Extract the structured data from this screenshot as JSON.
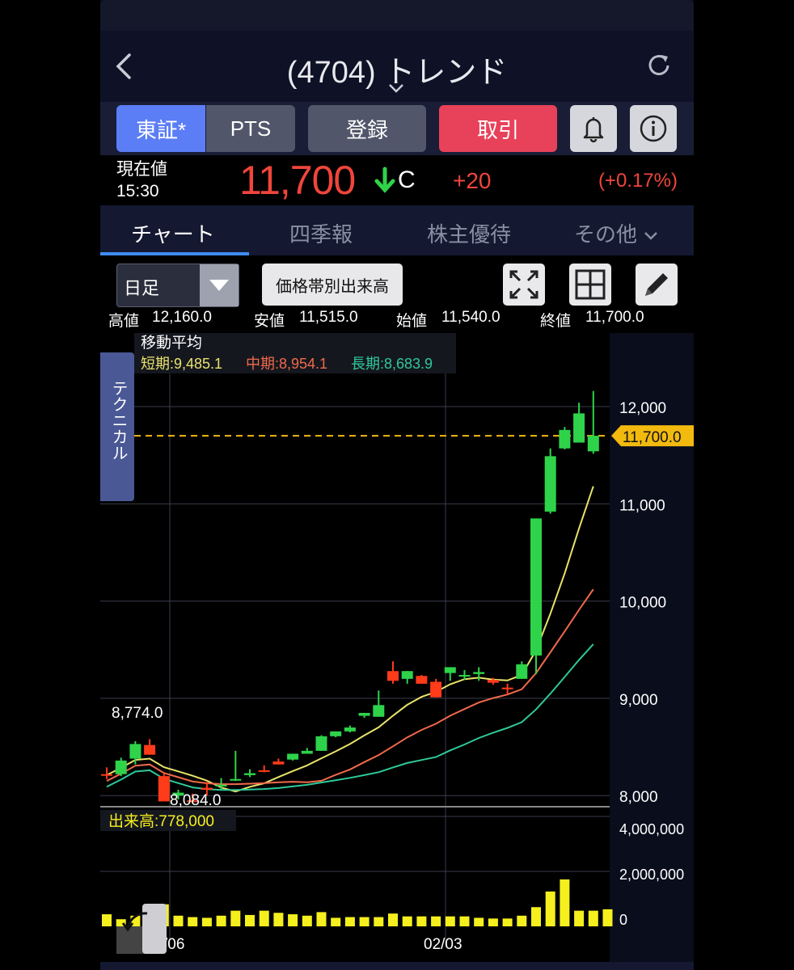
{
  "header": {
    "title": "(4704) トレンド",
    "back_icon": "chevron-left-icon",
    "refresh_icon": "refresh-icon"
  },
  "toolbar": {
    "tse_label": "東証*",
    "pts_label": "PTS",
    "register_label": "登録",
    "trade_label": "取引"
  },
  "price": {
    "label": "現在値",
    "time": "15:30",
    "value": "11,700",
    "suffix": "C",
    "change": "+20",
    "change_pct": "(+0.17%)"
  },
  "tabs": [
    "チャート",
    "四季報",
    "株主優待",
    "その他"
  ],
  "chart_controls": {
    "period": "日足",
    "volume_profile": "価格帯別出来高"
  },
  "ohlc": {
    "high_label": "高値",
    "high": "12,160.0",
    "low_label": "安値",
    "low": "11,515.0",
    "open_label": "始値",
    "open": "11,540.0",
    "close_label": "終値",
    "close": "11,700.0"
  },
  "colors": {
    "up": "#2ed34a",
    "down": "#ff3b1a",
    "short_ma": "#e9e36b",
    "mid_ma": "#f06a4a",
    "long_ma": "#2ec99a",
    "volume": "#f5ef1e",
    "accent": "#3f8cf2"
  },
  "chart_data": {
    "type": "candlestick",
    "title": "移動平均",
    "technical_tab": "テクニカル",
    "ma_legend": [
      {
        "name": "短期",
        "value": "9,485.1"
      },
      {
        "name": "中期",
        "value": "8,954.1"
      },
      {
        "name": "長期",
        "value": "8,683.9"
      }
    ],
    "price_ticks": [
      12000,
      11000,
      10000,
      9000,
      8000
    ],
    "price_tick_labels": [
      "12,000",
      "11,000",
      "10,000",
      "9,000",
      "8,000"
    ],
    "current_price_label": "11,700.0",
    "current_price": 11700,
    "max_annotation": "8,774.0",
    "min_annotation": "8,084.0",
    "volume_label": "出来高:778,000",
    "volume_ticks": [
      "4,000,000",
      "2,000,000",
      "0"
    ],
    "x_labels": [
      "/06",
      "02/03"
    ],
    "candles": [
      {
        "o": 8220,
        "h": 8290,
        "l": 8170,
        "c": 8210
      },
      {
        "o": 8220,
        "h": 8390,
        "l": 8200,
        "c": 8360
      },
      {
        "o": 8380,
        "h": 8560,
        "l": 8320,
        "c": 8530
      },
      {
        "o": 8520,
        "h": 8580,
        "l": 8430,
        "c": 8420
      },
      {
        "o": 8200,
        "h": 8230,
        "l": 7950,
        "c": 7940
      },
      {
        "o": 8000,
        "h": 8060,
        "l": 7960,
        "c": 8030
      },
      {
        "o": 7950,
        "h": 8020,
        "l": 7920,
        "c": 7940
      },
      {
        "o": 8080,
        "h": 8140,
        "l": 8000,
        "c": 8060
      },
      {
        "o": 8100,
        "h": 8180,
        "l": 8060,
        "c": 8110
      },
      {
        "o": 8160,
        "h": 8460,
        "l": 8150,
        "c": 8170
      },
      {
        "o": 8210,
        "h": 8270,
        "l": 8190,
        "c": 8230
      },
      {
        "o": 8260,
        "h": 8310,
        "l": 8240,
        "c": 8250
      },
      {
        "o": 8350,
        "h": 8380,
        "l": 8320,
        "c": 8320
      },
      {
        "o": 8370,
        "h": 8390,
        "l": 8360,
        "c": 8430
      },
      {
        "o": 8430,
        "h": 8490,
        "l": 8430,
        "c": 8460
      },
      {
        "o": 8460,
        "h": 8620,
        "l": 8460,
        "c": 8610
      },
      {
        "o": 8610,
        "h": 8660,
        "l": 8600,
        "c": 8660
      },
      {
        "o": 8660,
        "h": 8720,
        "l": 8650,
        "c": 8700
      },
      {
        "o": 8820,
        "h": 8850,
        "l": 8800,
        "c": 8850
      },
      {
        "o": 8810,
        "h": 9080,
        "l": 8810,
        "c": 8930
      },
      {
        "o": 9280,
        "h": 9380,
        "l": 9150,
        "c": 9180
      },
      {
        "o": 9200,
        "h": 9260,
        "l": 9150,
        "c": 9280
      },
      {
        "o": 9230,
        "h": 9240,
        "l": 9150,
        "c": 9150
      },
      {
        "o": 9170,
        "h": 9200,
        "l": 9030,
        "c": 9010
      },
      {
        "o": 9260,
        "h": 9300,
        "l": 9180,
        "c": 9320
      },
      {
        "o": 9230,
        "h": 9290,
        "l": 9190,
        "c": 9240
      },
      {
        "o": 9250,
        "h": 9320,
        "l": 9180,
        "c": 9270
      },
      {
        "o": 9190,
        "h": 9210,
        "l": 9140,
        "c": 9160
      },
      {
        "o": 9110,
        "h": 9150,
        "l": 9040,
        "c": 9100
      },
      {
        "o": 9200,
        "h": 9380,
        "l": 9200,
        "c": 9350
      },
      {
        "o": 9440,
        "h": 9430,
        "l": 9250,
        "c": 10850
      },
      {
        "o": 10920,
        "h": 11570,
        "l": 10900,
        "c": 11490
      },
      {
        "o": 11570,
        "h": 11790,
        "l": 11560,
        "c": 11760
      },
      {
        "o": 11630,
        "h": 12040,
        "l": 11630,
        "c": 11930
      },
      {
        "o": 11540,
        "h": 12160,
        "l": 11515,
        "c": 11700
      }
    ],
    "volumes": [
      0.34,
      0.2,
      0.3,
      0.22,
      0.62,
      0.3,
      0.26,
      0.24,
      0.3,
      0.44,
      0.32,
      0.44,
      0.38,
      0.34,
      0.3,
      0.4,
      0.24,
      0.26,
      0.26,
      0.26,
      0.36,
      0.28,
      0.28,
      0.28,
      0.28,
      0.28,
      0.24,
      0.22,
      0.22,
      0.3,
      0.54,
      0.98,
      1.32,
      0.44,
      0.44,
      0.48
    ]
  }
}
